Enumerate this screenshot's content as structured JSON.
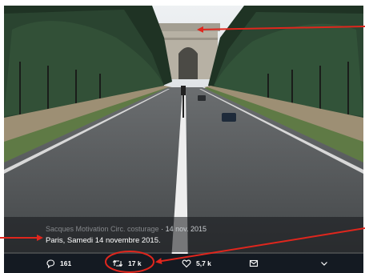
{
  "tweet": {
    "author_line": "Sacques Motivation Circ. costurage",
    "date": "· 14 nov. 2015",
    "caption": "Paris, Samedi 14 novembre 2015."
  },
  "actions": {
    "reply_count": "161",
    "retweet_count": "17 k",
    "like_count": "5,7 k"
  },
  "icons": [
    "reply-icon",
    "retweet-icon",
    "like-icon",
    "message-icon",
    "chevron-down-icon"
  ],
  "colors": {
    "annotation": "#e0261d",
    "action_bar": "#141a22",
    "overlay_text": "#ffffff"
  }
}
